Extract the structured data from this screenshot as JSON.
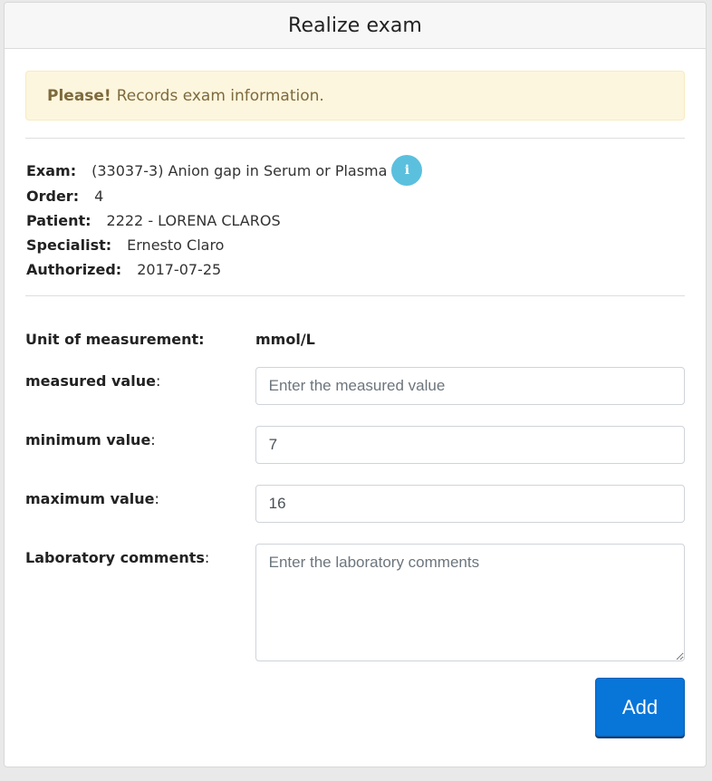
{
  "header": {
    "title": "Realize exam"
  },
  "alert": {
    "strong": "Please!",
    "text": "Records exam information."
  },
  "info": {
    "exam_label": "Exam:",
    "exam_value": "(33037-3) Anion gap in Serum or Plasma",
    "info_icon_glyph": "i",
    "order_label": "Order:",
    "order_value": "4",
    "patient_label": "Patient:",
    "patient_value": "2222 - LORENA CLAROS",
    "specialist_label": "Specialist:",
    "specialist_value": "Ernesto Claro",
    "authorized_label": "Authorized:",
    "authorized_value": "2017-07-25"
  },
  "form": {
    "unit_label": "Unit of measurement:",
    "unit_value": "mmol/L",
    "measured_label": "measured value",
    "measured_value": "",
    "measured_placeholder": "Enter the measured value",
    "minimum_label": "minimum value",
    "minimum_value": "7",
    "maximum_label": "maximum value",
    "maximum_value": "16",
    "comments_label": "Laboratory comments",
    "comments_placeholder": "Enter the laboratory comments",
    "colon": ":",
    "add_label": "Add"
  },
  "colors": {
    "primary": "#0875d9",
    "info_icon": "#5bc0de",
    "alert_bg": "#fdf6de",
    "alert_text": "#7d6a3d"
  }
}
